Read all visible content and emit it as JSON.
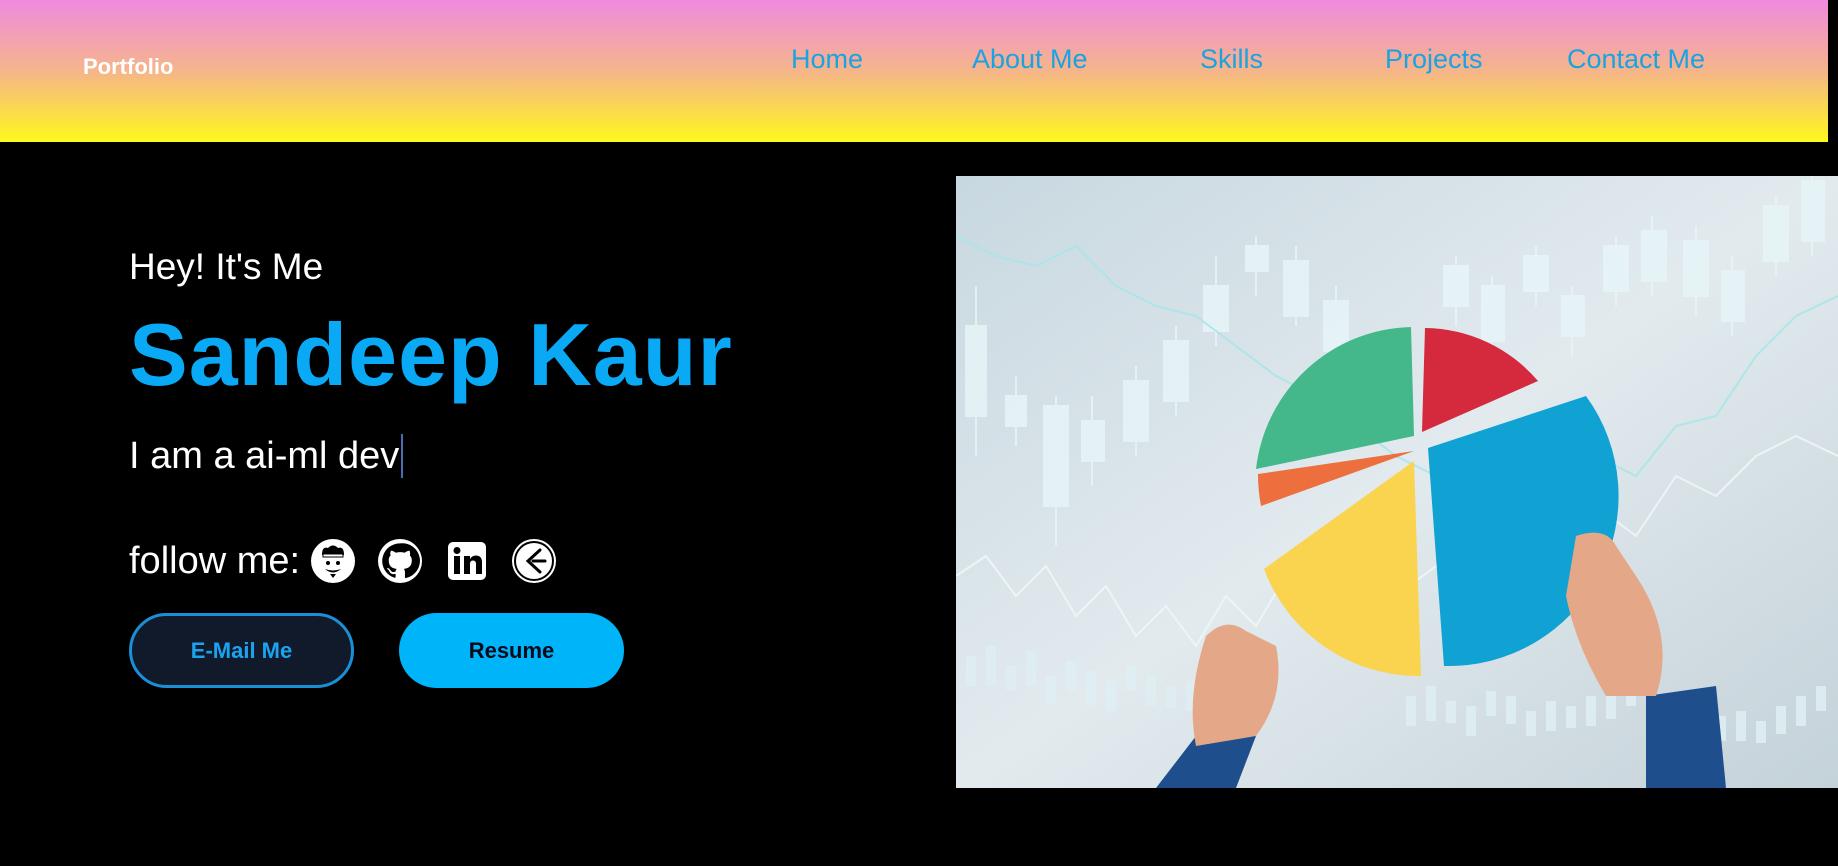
{
  "navbar": {
    "brand": "Portfolio",
    "links": [
      "Home",
      "About Me",
      "Skills",
      "Projects",
      "Contact Me"
    ]
  },
  "hero": {
    "greeting": "Hey! It's Me",
    "name": "Sandeep Kaur",
    "tagline": "I am a ai-ml dev",
    "follow_label": "follow me:",
    "social_icons": [
      "codechef-icon",
      "github-icon",
      "linkedin-icon",
      "leetcode-icon"
    ],
    "email_button": "E-Mail Me",
    "resume_button": "Resume",
    "image_icon": "pie-chart-financial-photo"
  },
  "colors": {
    "accent": "#09a9f5",
    "nav_link": "#1aa3e0",
    "background": "#000000",
    "nav_gradient_top": "#ef8ae0",
    "nav_gradient_bottom": "#fef81c",
    "resume_bg": "#00b4fa"
  }
}
